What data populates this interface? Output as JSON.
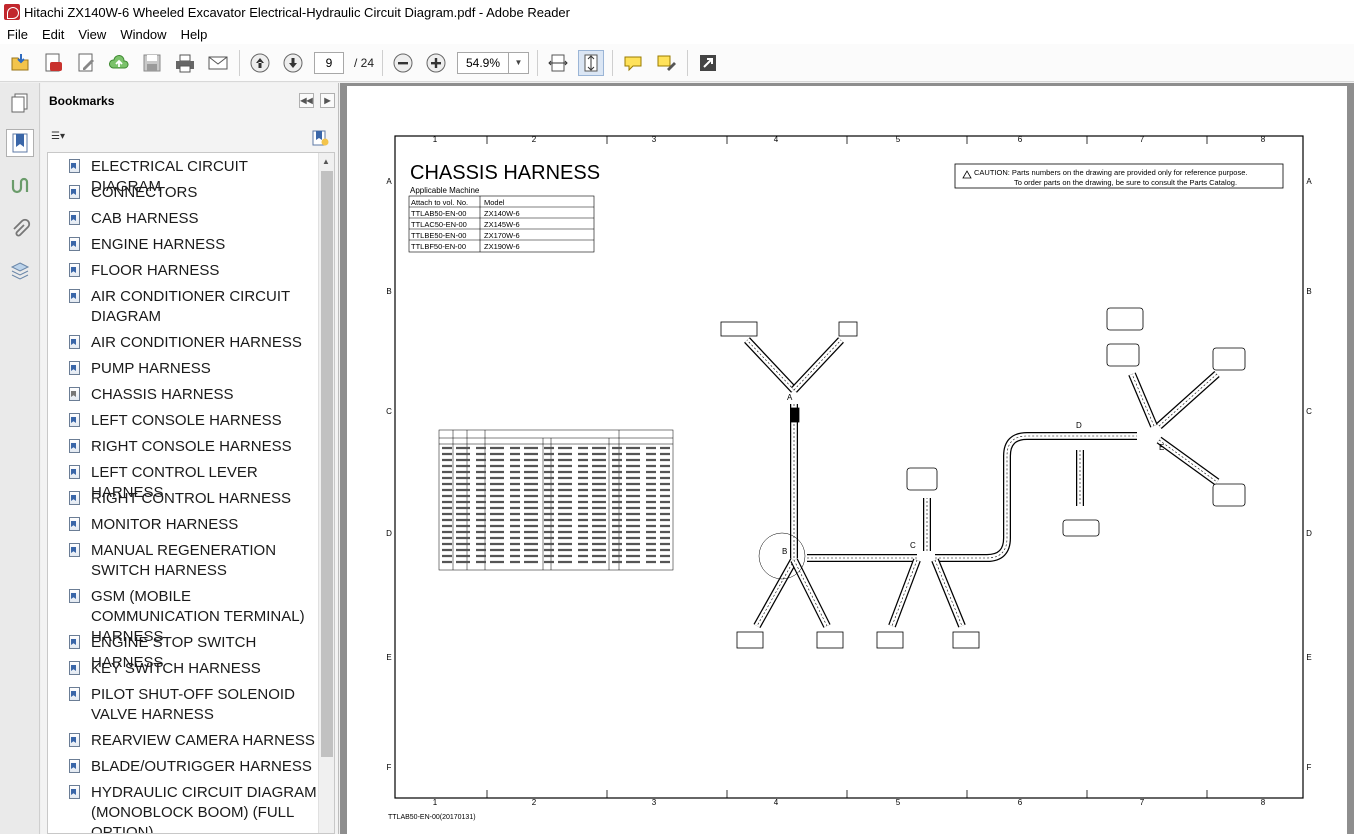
{
  "window": {
    "title": "Hitachi ZX140W-6 Wheeled Excavator Electrical-Hydraulic Circuit Diagram.pdf - Adobe Reader"
  },
  "menu": [
    "File",
    "Edit",
    "View",
    "Window",
    "Help"
  ],
  "toolbar": {
    "page_current": "9",
    "page_total": "/ 24",
    "zoom": "54.9%"
  },
  "bookmarks": {
    "title": "Bookmarks",
    "items": [
      {
        "label": "ELECTRICAL CIRCUIT DIAGRAM"
      },
      {
        "label": "CONNECTORS"
      },
      {
        "label": "CAB HARNESS"
      },
      {
        "label": "ENGINE HARNESS"
      },
      {
        "label": "FLOOR HARNESS"
      },
      {
        "label": "AIR CONDITIONER CIRCUIT DIAGRAM"
      },
      {
        "label": "AIR CONDITIONER HARNESS"
      },
      {
        "label": "PUMP HARNESS"
      },
      {
        "label": "CHASSIS HARNESS"
      },
      {
        "label": "LEFT CONSOLE HARNESS"
      },
      {
        "label": "RIGHT CONSOLE HARNESS"
      },
      {
        "label": "LEFT CONTROL LEVER HARNESS"
      },
      {
        "label": "RIGHT CONTROL HARNESS"
      },
      {
        "label": "MONITOR HARNESS"
      },
      {
        "label": "MANUAL REGENERATION SWITCH HARNESS"
      },
      {
        "label": "GSM (MOBILE COMMUNICATION TERMINAL) HARNESS"
      },
      {
        "label": "ENGINE STOP SWITCH HARNESS"
      },
      {
        "label": "KEY SWITCH HARNESS"
      },
      {
        "label": "PILOT SHUT-OFF SOLENOID VALVE HARNESS"
      },
      {
        "label": "REARVIEW CAMERA HARNESS"
      },
      {
        "label": "BLADE/OUTRIGGER HARNESS"
      },
      {
        "label": "HYDRAULIC CIRCUIT DIAGRAM (MONOBLOCK BOOM) (FULL OPTION)"
      }
    ]
  },
  "drawing": {
    "title": "CHASSIS HARNESS",
    "applicable_label": "Applicable Machine",
    "machine_table": {
      "headers": [
        "Attach to vol. No.",
        "Model"
      ],
      "rows": [
        [
          "TTLAB50-EN-00",
          "ZX140W-6"
        ],
        [
          "TTLAC50-EN-00",
          "ZX145W-6"
        ],
        [
          "TTLBE50-EN-00",
          "ZX170W-6"
        ],
        [
          "TTLBF50-EN-00",
          "ZX190W-6"
        ]
      ]
    },
    "caution_line1": "CAUTION: Parts numbers on the drawing are provided only for reference purpose.",
    "caution_line2": "To order parts on the drawing, be sure to consult the Parts Catalog.",
    "column_numbers": [
      "1",
      "2",
      "3",
      "4",
      "5",
      "6",
      "7",
      "8"
    ],
    "row_letters": [
      "A",
      "B",
      "C",
      "D",
      "E",
      "F"
    ],
    "node_labels": [
      "A",
      "B",
      "C",
      "D",
      "E"
    ],
    "footer": "TTLAB50-EN-00(20170131)"
  }
}
